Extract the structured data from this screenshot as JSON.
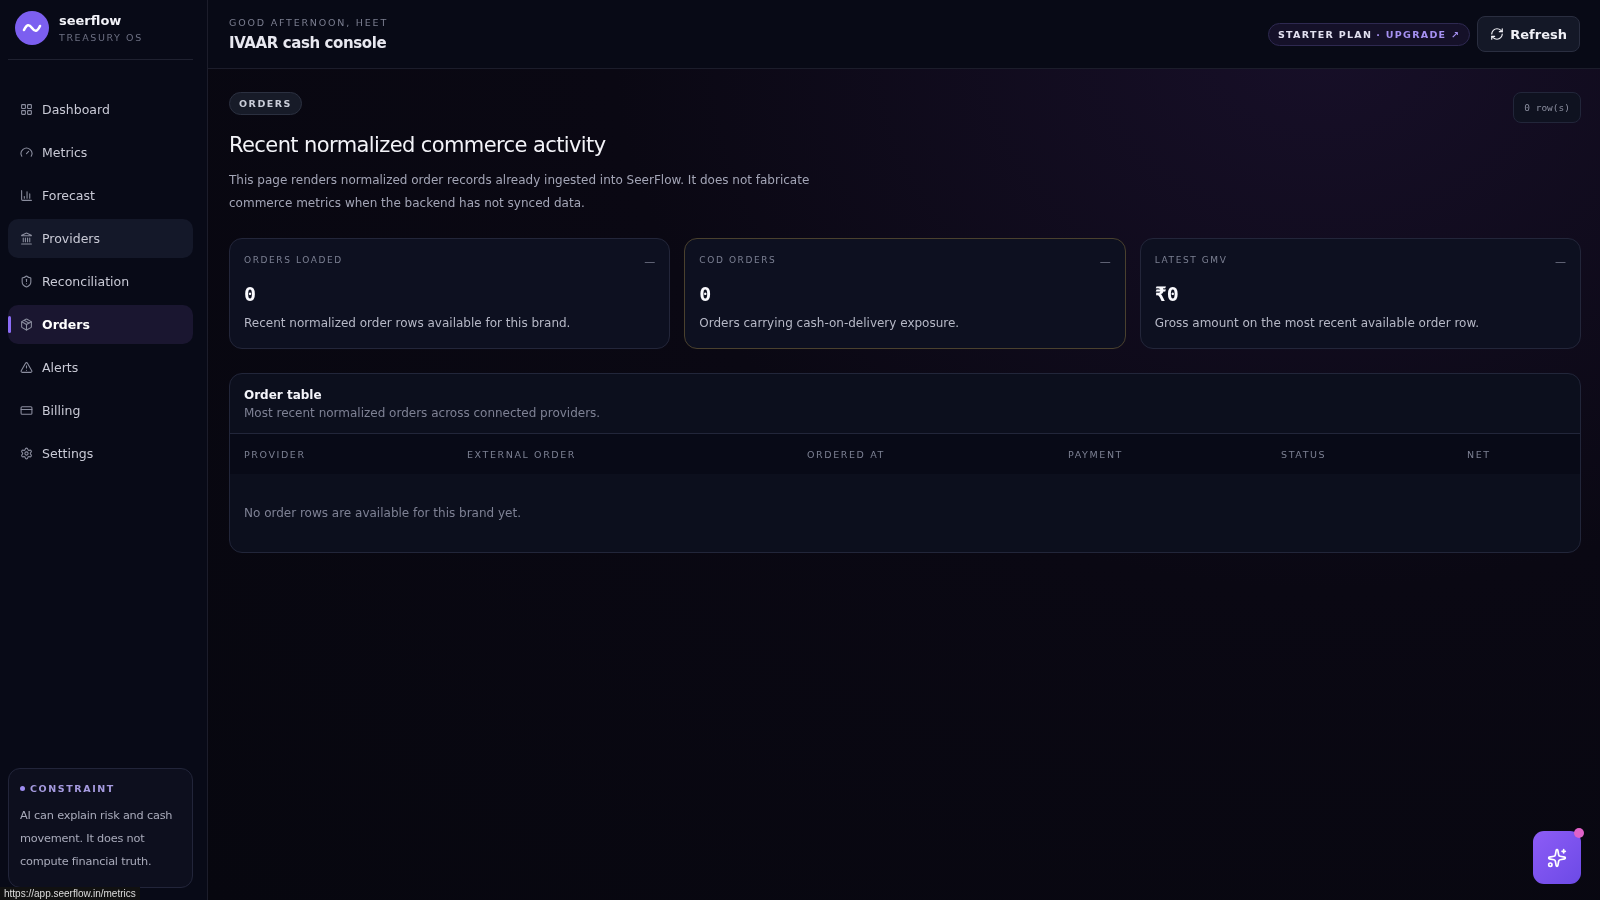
{
  "brand": {
    "name": "seerflow",
    "subtitle": "TREASURY OS"
  },
  "sidebar": {
    "items": [
      {
        "label": "Dashboard",
        "selected": false,
        "hovered": false
      },
      {
        "label": "Metrics",
        "selected": false,
        "hovered": false
      },
      {
        "label": "Forecast",
        "selected": false,
        "hovered": false
      },
      {
        "label": "Providers",
        "selected": false,
        "hovered": true
      },
      {
        "label": "Reconciliation",
        "selected": false,
        "hovered": false
      },
      {
        "label": "Orders",
        "selected": true,
        "hovered": false
      },
      {
        "label": "Alerts",
        "selected": false,
        "hovered": false
      },
      {
        "label": "Billing",
        "selected": false,
        "hovered": false
      },
      {
        "label": "Settings",
        "selected": false,
        "hovered": false
      }
    ],
    "note": {
      "title": "CONSTRAINT",
      "text": "AI can explain risk and cash movement. It does not compute financial truth."
    }
  },
  "header": {
    "greeting": "GOOD AFTERNOON, HEET",
    "title": "IVAAR cash console",
    "plan": "STARTER PLAN",
    "upgrade": "· UPGRADE ↗",
    "refresh": "Refresh"
  },
  "page": {
    "tag": "ORDERS",
    "row_count": "0 row(s)",
    "title": "Recent normalized commerce activity",
    "description": "This page renders normalized order records already ingested into SeerFlow. It does not fabricate commerce metrics when the backend has not synced data."
  },
  "stats": [
    {
      "label": "ORDERS LOADED",
      "value": "0",
      "note": "Recent normalized order rows available for this brand.",
      "trend": "—",
      "highlighted": false
    },
    {
      "label": "COD ORDERS",
      "value": "0",
      "note": "Orders carrying cash-on-delivery exposure.",
      "trend": "—",
      "highlighted": true
    },
    {
      "label": "LATEST GMV",
      "value": "₹0",
      "note": "Gross amount on the most recent available order row.",
      "trend": "—",
      "highlighted": false
    }
  ],
  "table": {
    "title": "Order table",
    "subtitle": "Most recent normalized orders across connected providers.",
    "columns": [
      "PROVIDER",
      "EXTERNAL ORDER",
      "ORDERED AT",
      "PAYMENT",
      "STATUS",
      "NET"
    ],
    "empty": "No order rows are available for this brand yet."
  },
  "status_bar": {
    "url": "https://app.seerflow.in/metrics"
  }
}
